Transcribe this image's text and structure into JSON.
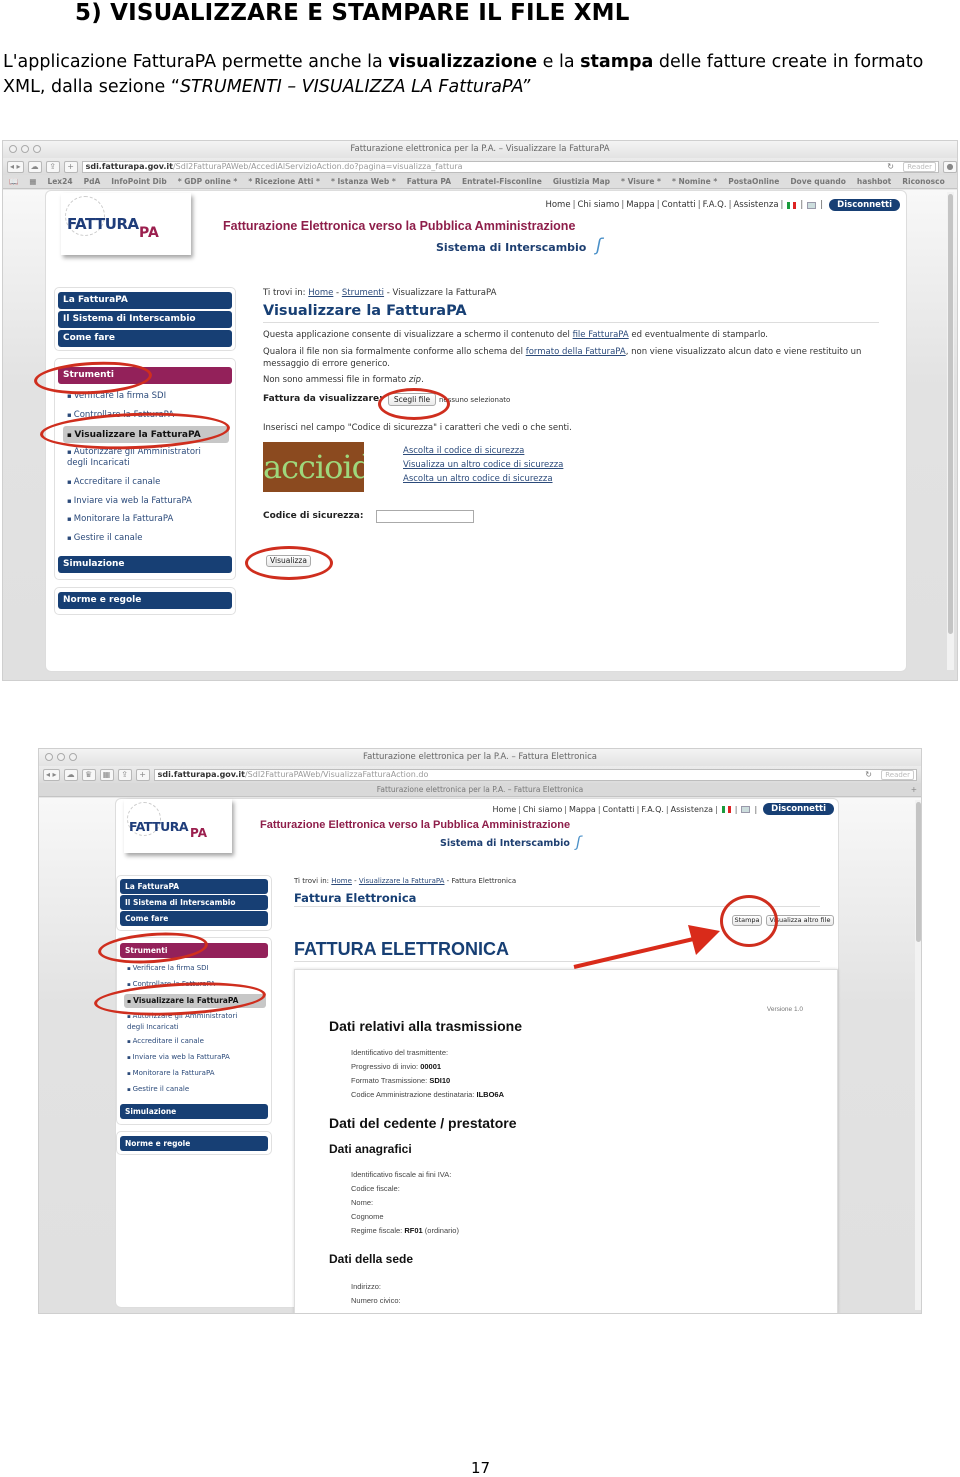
{
  "document": {
    "title": "5) VISUALIZZARE E STAMPARE IL FILE XML",
    "intro_part1": "L'applicazione FatturaPA permette anche la ",
    "intro_bold1": "visualizzazione",
    "intro_part2": " e la ",
    "intro_bold2": "stampa",
    "intro_part3": " delle fatture create in formato XML, dalla sezione “",
    "intro_italic": "STRUMENTI – VISUALIZZA LA FatturaPA”",
    "page_number": "17"
  },
  "screenshot1": {
    "window_title": "Fatturazione elettronica per la P.A. – Visualizzare la FatturaPA",
    "url_domain": "sdi.fatturapa.gov.it",
    "url_path": "/SdI2FatturaPAWeb/AccediAlServizioAction.do?pagina=visualizza_fattura",
    "reader_label": "Reader",
    "bookmarks": [
      "Lex24",
      "PdA",
      "InfoPoint Dib",
      "* GDP online *",
      "* Ricezione Atti *",
      "* Istanza Web *",
      "Fattura PA",
      "Entratel-Fisconline",
      "Giustizia Map",
      "* Visure *",
      "* Nomine *",
      "PostaOnline",
      "Dove quando",
      "hashbot",
      "Riconosco"
    ],
    "breadcrumb": {
      "prefix": "Ti trovi in: ",
      "home": "Home",
      "sep": " - ",
      "section": "Strumenti",
      "current": "Visualizzare la FatturaPA"
    },
    "heading": "Visualizzare la FatturaPA",
    "p1_before": "Questa applicazione consente di visualizzare a schermo il contenuto del ",
    "p1_link": "file FatturaPA",
    "p1_after": " ed eventualmente di stamparlo.",
    "p2_before": "Qualora il file non sia formalmente conforme allo schema del ",
    "p2_link": "formato della FatturaPA",
    "p2_after": ", non viene visualizzato alcun dato e viene restituito un messaggio di errore generico.",
    "p3_before": "Non sono ammessi file in formato ",
    "p3_italic": "zip",
    "p3_after": ".",
    "file_label": "Fattura da visualizzare:",
    "choose_file_button": "Scegli file",
    "no_file_text": "nessuno selezionato",
    "captcha_instruction": "Inserisci nel campo \"Codice di sicurezza\" i caratteri che vedi o che senti.",
    "captcha_text": "accioido",
    "captcha_links": [
      "Ascolta il codice di sicurezza",
      "Visualizza un altro codice di sicurezza",
      "Ascolta un altro codice di sicurezza"
    ],
    "security_label": "Codice di sicurezza:",
    "security_value": "",
    "submit_button": "Visualizza"
  },
  "screenshot2": {
    "window_title": "Fatturazione elettronica per la P.A. – Fattura Elettronica",
    "url_domain": "sdi.fatturapa.gov.it",
    "url_path": "/SdI2FatturaPAWeb/VisualizzaFatturaAction.do",
    "reader_label": "Reader",
    "tab_title": "Fatturazione elettronica per la P.A. – Fattura Elettronica",
    "breadcrumb": {
      "prefix": "Ti trovi in: ",
      "home": "Home",
      "sep": " - ",
      "section": "Visualizzare la FatturaPA",
      "current": "Fattura Elettronica"
    },
    "heading": "Fattura Elettronica",
    "print_button": "Stampa",
    "other_file_button": "Visualizza altro file",
    "big_title": "FATTURA ELETTRONICA",
    "invoice": {
      "version": "Versione 1.0",
      "section1_title": "Dati relativi alla trasmissione",
      "section1_rows": [
        {
          "label": "Identificativo del trasmittente:",
          "value": ""
        },
        {
          "label": "Progressivo di invio: ",
          "value": "00001"
        },
        {
          "label": "Formato Trasmissione: ",
          "value": "SDI10"
        },
        {
          "label": "Codice Amministrazione destinataria: ",
          "value": "ILBO6A"
        }
      ],
      "section2_title": "Dati del cedente / prestatore",
      "subsection_anagrafici": "Dati anagrafici",
      "anagrafici_rows": [
        {
          "label": "Identificativo fiscale ai fini IVA:",
          "value": ""
        },
        {
          "label": "Codice fiscale:",
          "value": ""
        },
        {
          "label": "Nome:",
          "value": ""
        },
        {
          "label": "Cognome",
          "value": ""
        },
        {
          "label": "Regime fiscale: ",
          "value": "RF01",
          "suffix": " (ordinario)"
        }
      ],
      "subsection_sede": "Dati della sede",
      "sede_rows": [
        {
          "label": "Indirizzo:",
          "value": ""
        },
        {
          "label": "Numero civico:",
          "value": ""
        }
      ]
    }
  },
  "site": {
    "logo_text": "FATTURA",
    "logo_pa": "PA",
    "topnav": [
      "Home",
      "Chi siamo",
      "Mappa",
      "Contatti",
      "F.A.Q.",
      "Assistenza"
    ],
    "disconnect_button": "Disconnetti",
    "title": "Fatturazione Elettronica verso la Pubblica Amministrazione",
    "subtitle": "Sistema di Interscambio",
    "sidebar_top": [
      "La FatturaPA",
      "Il Sistema di Interscambio",
      "Come fare"
    ],
    "sidebar_tools_header": "Strumenti",
    "sidebar_tools": [
      "Verificare la firma SDI",
      "Controllare la FatturaPA",
      "Visualizzare la FatturaPA",
      "Autorizzare gli Amministratori degli Incaricati",
      "Accreditare il canale",
      "Inviare via web la FatturaPA",
      "Monitorare la FatturaPA",
      "Gestire il canale"
    ],
    "sidebar_active_index": 2,
    "sidebar_simulation": "Simulazione",
    "sidebar_rules": "Norme e regole"
  },
  "colors": {
    "brand_blue": "#173f74",
    "brand_magenta": "#93215a",
    "annotation_red": "#cf2e1e"
  }
}
